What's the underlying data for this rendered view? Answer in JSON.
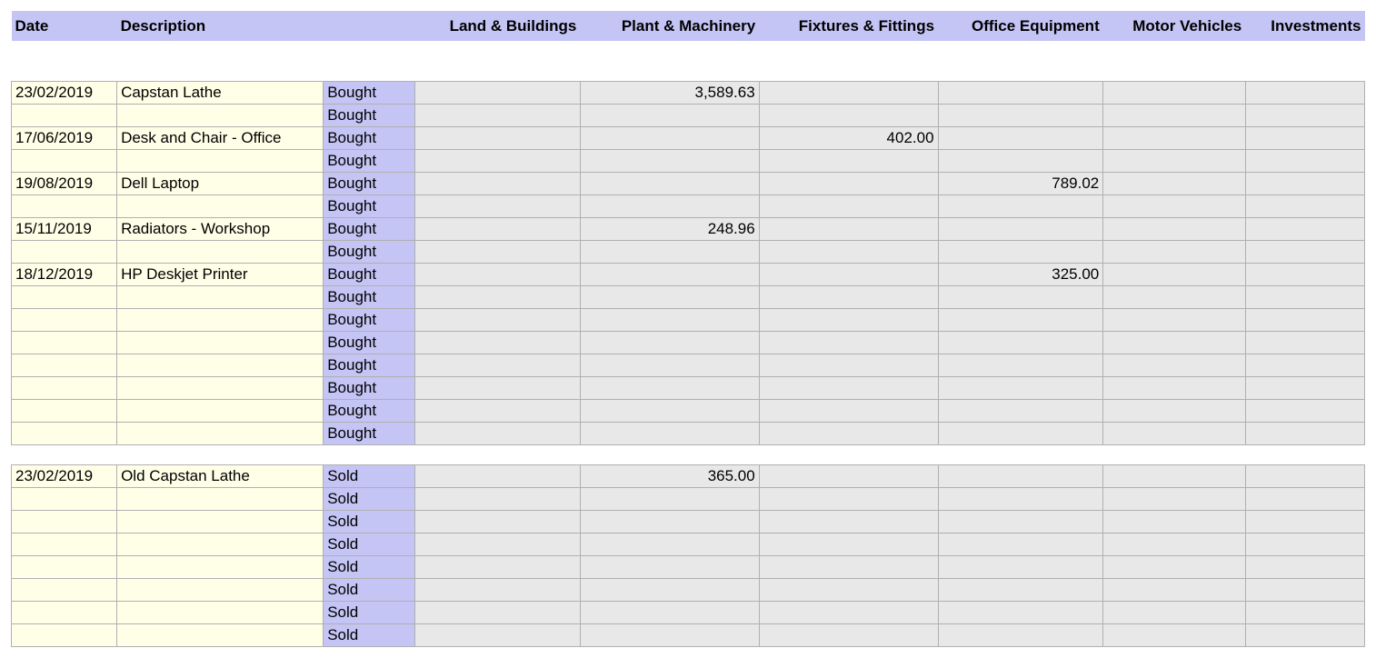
{
  "headers": {
    "date": "Date",
    "description": "Description",
    "status": "",
    "land": "Land & Buildings",
    "plant": "Plant & Machinery",
    "fixtures": "Fixtures & Fittings",
    "office": "Office Equipment",
    "motor": "Motor Vehicles",
    "invest": "Investments"
  },
  "status_labels": {
    "bought": "Bought",
    "sold": "Sold"
  },
  "bought_rows": [
    {
      "date": "23/02/2019",
      "desc": "Capstan Lathe",
      "land": "",
      "plant": "3,589.63",
      "fixtures": "",
      "office": "",
      "motor": "",
      "invest": ""
    },
    {
      "date": "",
      "desc": "",
      "land": "",
      "plant": "",
      "fixtures": "",
      "office": "",
      "motor": "",
      "invest": ""
    },
    {
      "date": "17/06/2019",
      "desc": "Desk and Chair - Office",
      "land": "",
      "plant": "",
      "fixtures": "402.00",
      "office": "",
      "motor": "",
      "invest": ""
    },
    {
      "date": "",
      "desc": "",
      "land": "",
      "plant": "",
      "fixtures": "",
      "office": "",
      "motor": "",
      "invest": ""
    },
    {
      "date": "19/08/2019",
      "desc": "Dell Laptop",
      "land": "",
      "plant": "",
      "fixtures": "",
      "office": "789.02",
      "motor": "",
      "invest": ""
    },
    {
      "date": "",
      "desc": "",
      "land": "",
      "plant": "",
      "fixtures": "",
      "office": "",
      "motor": "",
      "invest": ""
    },
    {
      "date": "15/11/2019",
      "desc": "Radiators - Workshop",
      "land": "",
      "plant": "248.96",
      "fixtures": "",
      "office": "",
      "motor": "",
      "invest": ""
    },
    {
      "date": "",
      "desc": "",
      "land": "",
      "plant": "",
      "fixtures": "",
      "office": "",
      "motor": "",
      "invest": ""
    },
    {
      "date": "18/12/2019",
      "desc": "HP Deskjet Printer",
      "land": "",
      "plant": "",
      "fixtures": "",
      "office": "325.00",
      "motor": "",
      "invest": ""
    },
    {
      "date": "",
      "desc": "",
      "land": "",
      "plant": "",
      "fixtures": "",
      "office": "",
      "motor": "",
      "invest": ""
    },
    {
      "date": "",
      "desc": "",
      "land": "",
      "plant": "",
      "fixtures": "",
      "office": "",
      "motor": "",
      "invest": ""
    },
    {
      "date": "",
      "desc": "",
      "land": "",
      "plant": "",
      "fixtures": "",
      "office": "",
      "motor": "",
      "invest": ""
    },
    {
      "date": "",
      "desc": "",
      "land": "",
      "plant": "",
      "fixtures": "",
      "office": "",
      "motor": "",
      "invest": ""
    },
    {
      "date": "",
      "desc": "",
      "land": "",
      "plant": "",
      "fixtures": "",
      "office": "",
      "motor": "",
      "invest": ""
    },
    {
      "date": "",
      "desc": "",
      "land": "",
      "plant": "",
      "fixtures": "",
      "office": "",
      "motor": "",
      "invest": ""
    },
    {
      "date": "",
      "desc": "",
      "land": "",
      "plant": "",
      "fixtures": "",
      "office": "",
      "motor": "",
      "invest": ""
    }
  ],
  "sold_rows": [
    {
      "date": "23/02/2019",
      "desc": "Old Capstan Lathe",
      "land": "",
      "plant": "365.00",
      "fixtures": "",
      "office": "",
      "motor": "",
      "invest": ""
    },
    {
      "date": "",
      "desc": "",
      "land": "",
      "plant": "",
      "fixtures": "",
      "office": "",
      "motor": "",
      "invest": ""
    },
    {
      "date": "",
      "desc": "",
      "land": "",
      "plant": "",
      "fixtures": "",
      "office": "",
      "motor": "",
      "invest": ""
    },
    {
      "date": "",
      "desc": "",
      "land": "",
      "plant": "",
      "fixtures": "",
      "office": "",
      "motor": "",
      "invest": ""
    },
    {
      "date": "",
      "desc": "",
      "land": "",
      "plant": "",
      "fixtures": "",
      "office": "",
      "motor": "",
      "invest": ""
    },
    {
      "date": "",
      "desc": "",
      "land": "",
      "plant": "",
      "fixtures": "",
      "office": "",
      "motor": "",
      "invest": ""
    },
    {
      "date": "",
      "desc": "",
      "land": "",
      "plant": "",
      "fixtures": "",
      "office": "",
      "motor": "",
      "invest": ""
    },
    {
      "date": "",
      "desc": "",
      "land": "",
      "plant": "",
      "fixtures": "",
      "office": "",
      "motor": "",
      "invest": ""
    }
  ]
}
